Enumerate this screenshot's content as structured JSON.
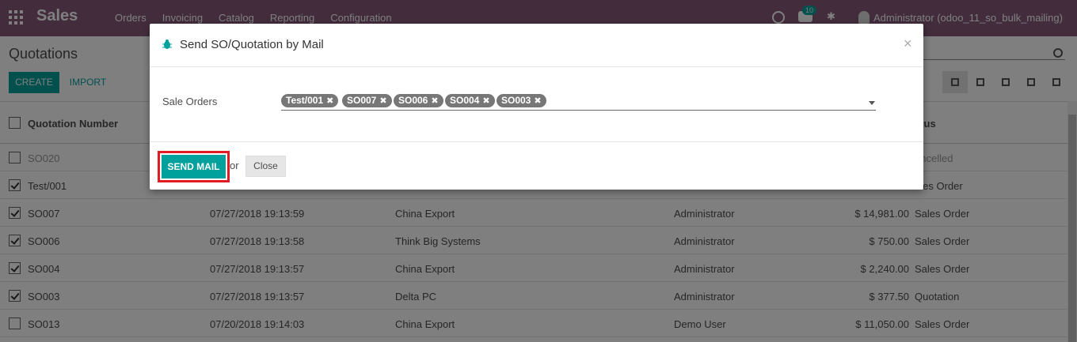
{
  "navbar": {
    "brand": "Sales",
    "menu": [
      "Orders",
      "Invoicing",
      "Catalog",
      "Reporting",
      "Configuration"
    ],
    "messages_badge": "10",
    "user": "Administrator (odoo_11_so_bulk_mailing)"
  },
  "control": {
    "title": "Quotations",
    "create_label": "CREATE",
    "import_label": "IMPORT"
  },
  "list": {
    "header": {
      "number": "Quotation Number",
      "status": "atus"
    },
    "rows": [
      {
        "number": "SO020",
        "date": "",
        "customer": "",
        "salesperson": "",
        "total": "",
        "status": "ancelled",
        "checked": false,
        "muted": true
      },
      {
        "number": "Test/001",
        "date": "",
        "customer": "",
        "salesperson": "",
        "total": "",
        "status": "ales Order",
        "checked": true,
        "muted": false
      },
      {
        "number": "SO007",
        "date": "07/27/2018 19:13:59",
        "customer": "China Export",
        "salesperson": "Administrator",
        "total": "$ 14,981.00",
        "status": "Sales Order",
        "checked": true,
        "muted": false
      },
      {
        "number": "SO006",
        "date": "07/27/2018 19:13:58",
        "customer": "Think Big Systems",
        "salesperson": "Administrator",
        "total": "$ 750.00",
        "status": "Sales Order",
        "checked": true,
        "muted": false
      },
      {
        "number": "SO004",
        "date": "07/27/2018 19:13:57",
        "customer": "China Export",
        "salesperson": "Administrator",
        "total": "$ 2,240.00",
        "status": "Sales Order",
        "checked": true,
        "muted": false
      },
      {
        "number": "SO003",
        "date": "07/27/2018 19:13:57",
        "customer": "Delta PC",
        "salesperson": "Administrator",
        "total": "$ 377.50",
        "status": "Quotation",
        "checked": true,
        "muted": false
      },
      {
        "number": "SO013",
        "date": "07/20/2018 19:14:03",
        "customer": "China Export",
        "salesperson": "Demo User",
        "total": "$ 11,050.00",
        "status": "Sales Order",
        "checked": false,
        "muted": false
      }
    ]
  },
  "modal": {
    "title": "Send SO/Quotation by Mail",
    "field_label": "Sale Orders",
    "tags": [
      "Test/001",
      "SO007",
      "SO006",
      "SO004",
      "SO003"
    ],
    "send_label": "SEND MAIL",
    "or_text": "or",
    "close_label": "Close",
    "x_label": "×"
  },
  "colors": {
    "navbar": "#875a7b",
    "accent": "#00a09d",
    "highlight": "#e01b24"
  }
}
